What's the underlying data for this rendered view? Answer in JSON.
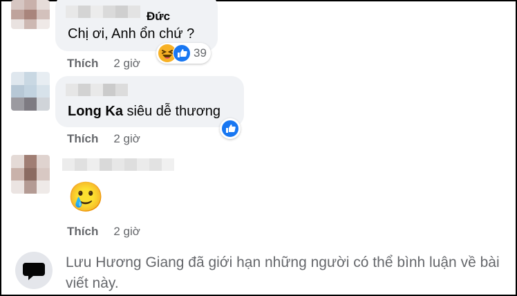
{
  "comments": [
    {
      "author_suffix": "Đức",
      "text": "Chị ơi, Anh ổn chứ ?",
      "like_label": "Thích",
      "time": "2 giờ",
      "reaction_icons": [
        "laughing-face-icon",
        "thumbs-up-icon"
      ],
      "reaction_count": "39"
    },
    {
      "mention": "Long Ka",
      "text": " siêu dễ thương",
      "like_label": "Thích",
      "time": "2 giờ",
      "reaction_icons": [
        "thumbs-up-icon"
      ]
    },
    {
      "emoji": "🥲",
      "like_label": "Thích",
      "time": "2 giờ"
    }
  ],
  "notice": {
    "text": "Lưu Hương Giang đã giới hạn những người có thể bình luận về bài viết này.",
    "icon": "speech-bubble-icon"
  },
  "colors": {
    "bubble_bg": "#f0f2f5",
    "like_blue": "#1877f2",
    "haha_yellow": "#f7b125",
    "secondary_text": "#65676b"
  }
}
